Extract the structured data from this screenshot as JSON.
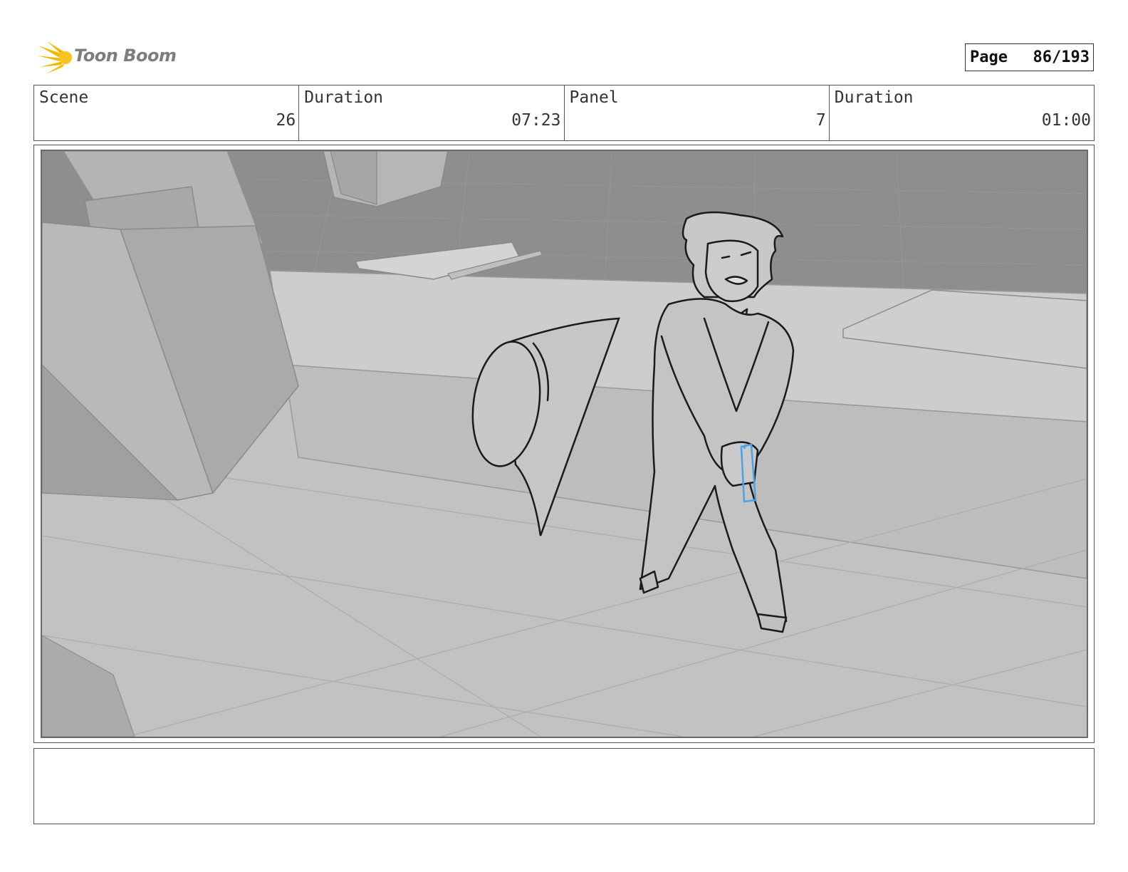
{
  "header": {
    "logo_text": "Toon Boom",
    "page_label": "Page",
    "page_value": "86/193"
  },
  "info": {
    "scene_label": "Scene",
    "scene_value": "26",
    "scene_duration_label": "Duration",
    "scene_duration_value": "07:23",
    "panel_label": "Panel",
    "panel_value": "7",
    "panel_duration_label": "Duration",
    "panel_duration_value": "01:00"
  },
  "panel": {
    "icon": "storyboard-sketch",
    "colors": {
      "background": "#bdbdbd",
      "back_wall": "#8f8f8f",
      "sketch_line": "#1a1a1a",
      "prop_highlight": "#4aa3e8"
    }
  },
  "notes": {
    "text": ""
  }
}
